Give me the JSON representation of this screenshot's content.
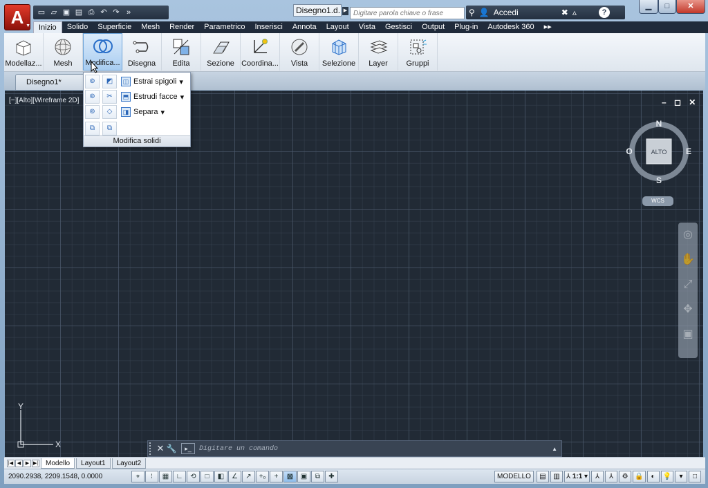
{
  "app": {
    "logo_letter": "A",
    "document_title": "Disegno1.d..."
  },
  "qat": {
    "icons": [
      "new-icon",
      "open-icon",
      "save-icon",
      "saveas-icon",
      "print-icon",
      "undo-icon",
      "redo-icon",
      "more-icon"
    ]
  },
  "search": {
    "placeholder": "Digitare parola chiave o frase"
  },
  "account": {
    "signin_label": "Accedi",
    "help_label": "?"
  },
  "window_controls": {
    "min": "▁",
    "max": "□",
    "close": "✕"
  },
  "tabs": [
    "Inizio",
    "Solido",
    "Superficie",
    "Mesh",
    "Render",
    "Parametrico",
    "Inserisci",
    "Annota",
    "Layout",
    "Vista",
    "Gestisci",
    "Output",
    "Plug-in",
    "Autodesk 360",
    "▸▸"
  ],
  "ribbon": {
    "panels": [
      {
        "label": "Modellaz...",
        "icon": "box-icon"
      },
      {
        "label": "Mesh",
        "icon": "sphere-mesh-icon"
      },
      {
        "label": "Modifica...",
        "icon": "union-icon"
      },
      {
        "label": "Disegna",
        "icon": "polyline-icon"
      },
      {
        "label": "Edita",
        "icon": "edit-icon"
      },
      {
        "label": "Sezione",
        "icon": "section-plane-icon"
      },
      {
        "label": "Coordina...",
        "icon": "ucs-icon"
      },
      {
        "label": "Vista",
        "icon": "view-icon"
      },
      {
        "label": "Selezione",
        "icon": "selection-cube-icon"
      },
      {
        "label": "Layer",
        "icon": "layers-icon"
      },
      {
        "label": "Gruppi",
        "icon": "groups-icon"
      }
    ]
  },
  "doc_tabs": {
    "active": "Disegno1*"
  },
  "popup": {
    "items": [
      {
        "label": "Estrai spigoli",
        "arrow": "▾"
      },
      {
        "label": "Estrudi facce",
        "arrow": "▾"
      },
      {
        "label": "Separa",
        "arrow": "▾"
      }
    ],
    "footer": "Modifica solidi"
  },
  "viewport": {
    "label": "[−][Alto][Wireframe 2D]",
    "controls": "– ◻ ✕",
    "viewcube": {
      "north": "N",
      "south": "S",
      "east": "E",
      "west": "O",
      "face": "ALTO"
    },
    "wcs": "WCS",
    "ucs": {
      "x": "X",
      "y": "Y"
    }
  },
  "command": {
    "placeholder": "Digitare un comando",
    "close": "✕",
    "settings": "🔧"
  },
  "layout_tabs": [
    "Modello",
    "Layout1",
    "Layout2"
  ],
  "status": {
    "coords": "2090.2938, 2209.1548, 0.0000",
    "space": "MODELLO",
    "scale": "1:1"
  }
}
